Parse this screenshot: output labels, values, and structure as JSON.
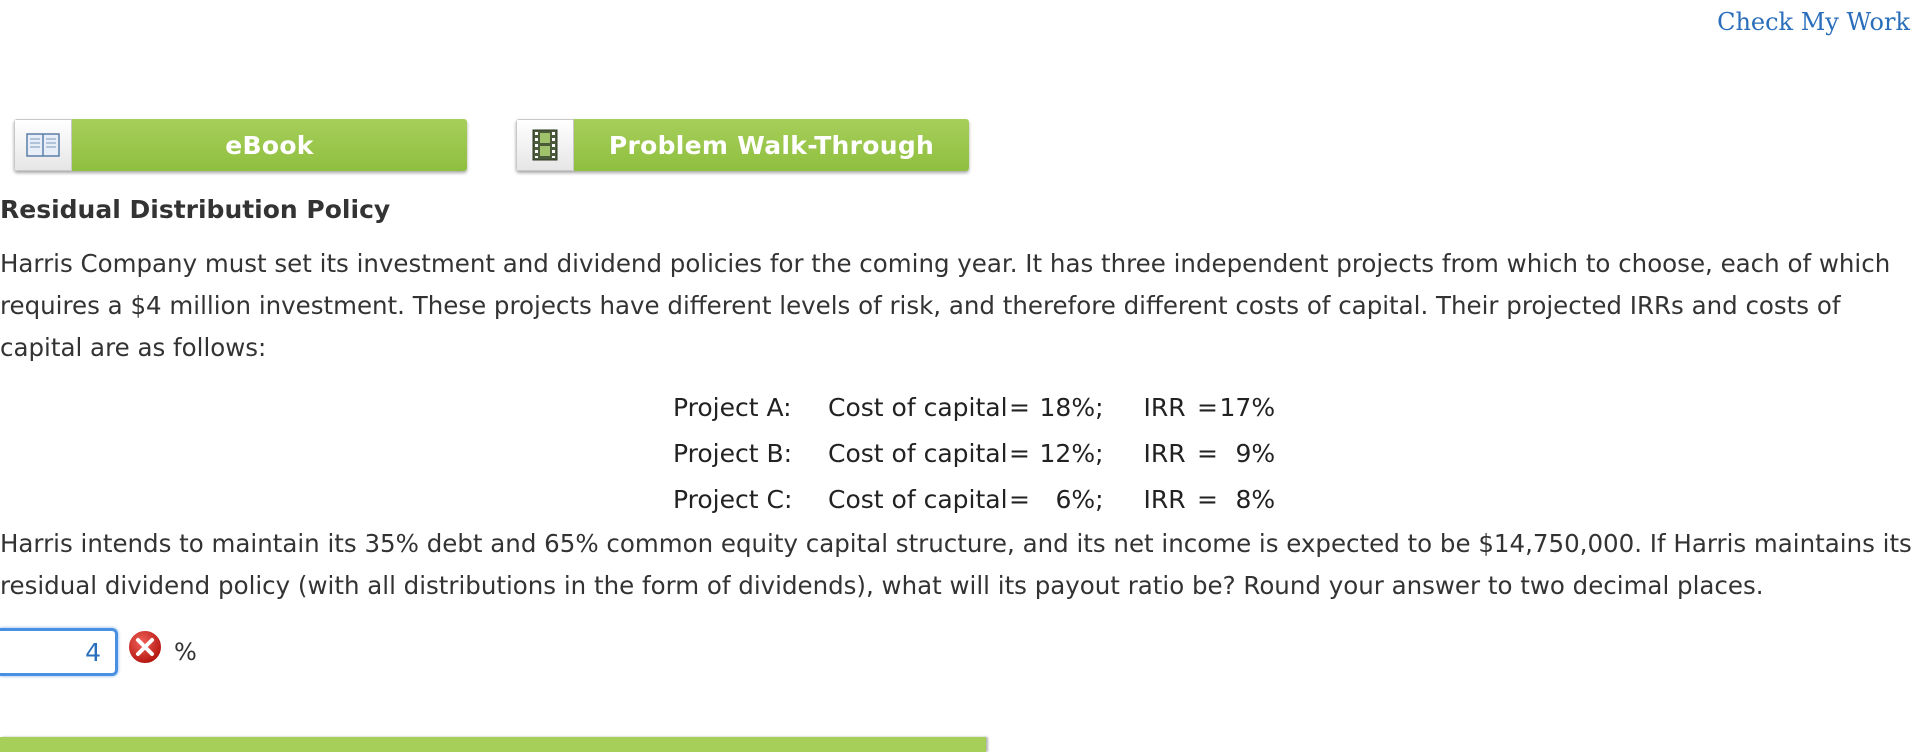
{
  "header": {
    "check_link": "Check My Work"
  },
  "buttons": {
    "ebook": {
      "label": "eBook",
      "icon": "book-icon"
    },
    "walkthrough": {
      "label": "Problem Walk-Through",
      "icon": "film-icon"
    }
  },
  "problem": {
    "title": "Residual Distribution Policy",
    "intro": "Harris Company must set its investment and dividend policies for the coming year. It has three independent projects from which to choose, each of which requires a $4 million investment. These projects have different levels of risk, and therefore different costs of capital. Their projected IRRs and costs of capital are as follows:",
    "projects": [
      {
        "name": "Project A:",
        "cost_label": "Cost of capital",
        "eq": "=",
        "cost": "18%;",
        "irr_label": "IRR",
        "irr": "17%"
      },
      {
        "name": "Project B:",
        "cost_label": "Cost of capital",
        "eq": "=",
        "cost": "12%;",
        "irr_label": "IRR",
        "irr": "9%"
      },
      {
        "name": "Project C:",
        "cost_label": "Cost of capital",
        "eq": "=",
        "cost": "6%;",
        "irr_label": "IRR",
        "irr": "8%"
      }
    ],
    "question": "Harris intends to maintain its 35% debt and 65% common equity capital structure, and its net income is expected to be $14,750,000. If Harris maintains its residual dividend policy (with all distributions in the form of dividends), what will its payout ratio be? Round your answer to two decimal places."
  },
  "answer": {
    "value": "4",
    "unit": "%",
    "status_icon": "error-x-icon"
  },
  "colors": {
    "accent_green": "#9cc94d",
    "link_blue": "#2a6ebb",
    "error_red": "#d9241c"
  }
}
